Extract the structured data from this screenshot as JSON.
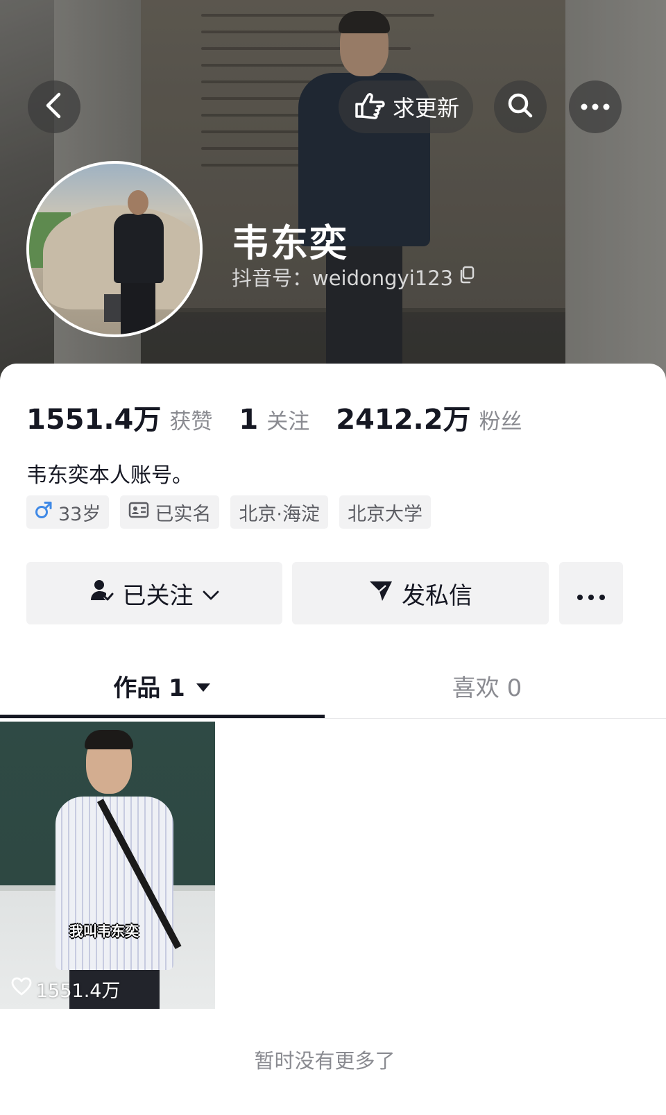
{
  "header": {
    "back_icon": "chevron-left-icon",
    "update_label": "求更新",
    "update_icon": "pointing-hand-icon",
    "search_icon": "search-icon",
    "more_icon": "more-dots-icon"
  },
  "profile": {
    "name": "韦东奕",
    "douyin_id": "抖音号：weidongyi123",
    "copy_icon": "copy-icon"
  },
  "stats": [
    {
      "value": "1551.4万",
      "label": "获赞"
    },
    {
      "value": "1",
      "label": "关注"
    },
    {
      "value": "2412.2万",
      "label": "粉丝"
    }
  ],
  "bio": "韦东奕本人账号。",
  "tags": [
    {
      "icon": "male-icon",
      "label": "33岁"
    },
    {
      "icon": "id-card-icon",
      "label": "已实名"
    },
    {
      "label": "北京·海淀"
    },
    {
      "label": "北京大学"
    }
  ],
  "actions": {
    "follow_label": "已关注",
    "message_label": "发私信"
  },
  "tabs": {
    "works_label": "作品 1",
    "likes_label": "喜欢 0"
  },
  "video": {
    "caption": "我叫韦东奕",
    "likes": "1551.4万"
  },
  "footer": {
    "no_more": "暂时没有更多了"
  },
  "colors": {
    "text_primary": "#161823",
    "text_secondary": "#8a8b91",
    "tag_bg": "#f2f2f3",
    "male_blue": "#3f89e6"
  }
}
